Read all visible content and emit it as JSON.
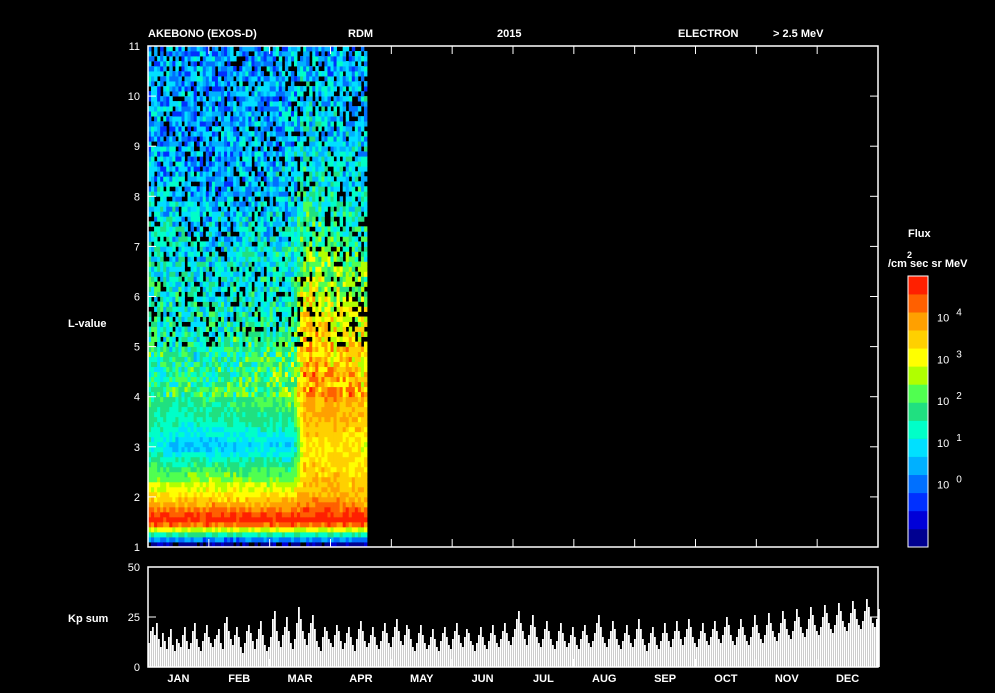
{
  "header": {
    "satellite": "AKEBONO (EXOS-D)",
    "instrument": "RDM",
    "year": "2015",
    "particle": "ELECTRON",
    "energy": "> 2.5 MeV"
  },
  "chart_data": [
    {
      "type": "heatmap",
      "ylabel": "L-value",
      "ylim": [
        1,
        11
      ],
      "y_ticks": [
        "1",
        "2",
        "3",
        "4",
        "5",
        "6",
        "7",
        "8",
        "9",
        "10",
        "11"
      ],
      "x_categories": [
        "JAN",
        "FEB",
        "MAR",
        "APR",
        "MAY",
        "JUN",
        "JUL",
        "AUG",
        "SEP",
        "OCT",
        "NOV",
        "DEC"
      ],
      "data_coverage_months": [
        0.0,
        3.6
      ],
      "colorbar": {
        "title": "Flux",
        "units_main": "/cm sec sr MeV",
        "units_exp": "2",
        "scale": "log",
        "labels": [
          {
            "base": "10",
            "exp": "0",
            "logv": 0
          },
          {
            "base": "10",
            "exp": "1",
            "logv": 1
          },
          {
            "base": "10",
            "exp": "2",
            "logv": 2
          },
          {
            "base": "10",
            "exp": "3",
            "logv": 3
          },
          {
            "base": "10",
            "exp": "4",
            "logv": 4
          }
        ],
        "range_log": [
          -1.5,
          5.0
        ],
        "colors": [
          "#000090",
          "#0000d8",
          "#0030ff",
          "#0070ff",
          "#00b0ff",
          "#00e0ff",
          "#00ffc8",
          "#20e080",
          "#50ff50",
          "#b0ff00",
          "#ffff00",
          "#ffd000",
          "#ffa000",
          "#ff6000",
          "#ff2000"
        ]
      },
      "profiles": [
        {
          "m": 0.0,
          "L": [
            1.0,
            1.5,
            2.0,
            2.5,
            3.0,
            3.5,
            4.0,
            5.0,
            6.0,
            7.0,
            8.5,
            11.0
          ],
          "logf": [
            -2,
            5.0,
            3.4,
            2.1,
            1.2,
            1.7,
            1.8,
            1.6,
            1.4,
            1.2,
            0.6,
            0.3
          ]
        },
        {
          "m": 0.5,
          "L": [
            1.0,
            1.5,
            2.0,
            2.5,
            3.0,
            3.5,
            4.0,
            5.0,
            6.0,
            7.0,
            8.5,
            11.0
          ],
          "logf": [
            -2,
            5.0,
            3.3,
            2.0,
            0.6,
            1.4,
            1.6,
            1.4,
            1.2,
            1.0,
            0.5,
            0.3
          ]
        },
        {
          "m": 1.0,
          "L": [
            1.0,
            1.5,
            2.0,
            2.5,
            3.0,
            3.5,
            4.0,
            5.0,
            6.0,
            7.0,
            8.5,
            11.0
          ],
          "logf": [
            -2,
            5.0,
            3.4,
            2.2,
            0.6,
            1.5,
            1.8,
            1.5,
            1.1,
            0.8,
            0.4,
            0.3
          ]
        },
        {
          "m": 1.5,
          "L": [
            1.0,
            1.5,
            2.0,
            2.5,
            3.0,
            3.5,
            4.0,
            5.0,
            6.0,
            7.0,
            8.5,
            11.0
          ],
          "logf": [
            -2,
            5.0,
            3.3,
            2.0,
            0.8,
            1.6,
            1.9,
            1.6,
            1.3,
            0.9,
            0.5,
            0.3
          ]
        },
        {
          "m": 2.4,
          "L": [
            1.0,
            1.5,
            2.0,
            2.5,
            3.0,
            3.5,
            4.0,
            5.0,
            6.0,
            7.0,
            8.5,
            11.0
          ],
          "logf": [
            -2,
            5.0,
            3.3,
            2.0,
            0.8,
            1.6,
            2.4,
            1.8,
            1.4,
            1.1,
            0.7,
            0.4
          ]
        },
        {
          "m": 2.55,
          "L": [
            1.0,
            1.5,
            2.0,
            2.5,
            3.0,
            3.5,
            4.0,
            5.0,
            6.0,
            7.0,
            8.5,
            11.0
          ],
          "logf": [
            -2,
            5.0,
            3.8,
            3.5,
            3.3,
            3.6,
            3.8,
            3.6,
            3.1,
            2.1,
            1.2,
            0.6
          ]
        },
        {
          "m": 3.0,
          "L": [
            1.0,
            1.5,
            2.0,
            2.5,
            3.0,
            3.5,
            4.0,
            5.0,
            6.0,
            7.0,
            8.5,
            11.0
          ],
          "logf": [
            -2,
            5.0,
            3.9,
            3.4,
            3.3,
            3.7,
            3.9,
            3.5,
            2.7,
            1.8,
            1.0,
            0.5
          ]
        },
        {
          "m": 3.6,
          "L": [
            1.0,
            1.5,
            2.0,
            2.5,
            3.0,
            3.5,
            4.0,
            5.0,
            6.0,
            7.0,
            8.5,
            11.0
          ],
          "logf": [
            -2,
            5.0,
            3.6,
            3.3,
            3.1,
            3.5,
            3.6,
            3.2,
            2.4,
            1.6,
            0.9,
            0.5
          ]
        }
      ]
    },
    {
      "type": "bar",
      "ylabel": "Kp sum",
      "ylim": [
        0,
        50
      ],
      "y_ticks": [
        "0",
        "25",
        "50"
      ],
      "x_categories": [
        "JAN",
        "FEB",
        "MAR",
        "APR",
        "MAY",
        "JUN",
        "JUL",
        "AUG",
        "SEP",
        "OCT",
        "NOV",
        "DEC"
      ],
      "days_per_month": [
        31,
        28,
        31,
        30,
        31,
        30,
        31,
        31,
        30,
        31,
        30,
        31
      ],
      "values": [
        12,
        18,
        20,
        16,
        22,
        14,
        10,
        17,
        13,
        9,
        15,
        19,
        11,
        8,
        14,
        12,
        10,
        16,
        20,
        13,
        9,
        12,
        18,
        22,
        14,
        10,
        8,
        13,
        17,
        21,
        15,
        12,
        10,
        14,
        16,
        19,
        12,
        9,
        22,
        25,
        18,
        14,
        11,
        16,
        20,
        15,
        10,
        7,
        12,
        18,
        21,
        17,
        13,
        9,
        14,
        19,
        23,
        16,
        11,
        8,
        10,
        15,
        24,
        28,
        18,
        13,
        10,
        16,
        20,
        25,
        18,
        12,
        9,
        14,
        22,
        30,
        24,
        18,
        14,
        11,
        17,
        22,
        26,
        19,
        13,
        10,
        8,
        15,
        20,
        18,
        14,
        12,
        10,
        16,
        21,
        18,
        13,
        9,
        12,
        17,
        20,
        15,
        11,
        8,
        14,
        19,
        23,
        18,
        13,
        10,
        12,
        16,
        20,
        15,
        11,
        9,
        13,
        18,
        22,
        17,
        12,
        10,
        15,
        20,
        24,
        18,
        13,
        11,
        16,
        21,
        19,
        14,
        10,
        8,
        12,
        17,
        21,
        16,
        12,
        9,
        11,
        15,
        19,
        14,
        10,
        8,
        13,
        17,
        20,
        15,
        11,
        9,
        14,
        18,
        22,
        16,
        12,
        10,
        15,
        19,
        17,
        13,
        11,
        8,
        12,
        16,
        20,
        15,
        11,
        9,
        13,
        17,
        21,
        16,
        12,
        10,
        14,
        18,
        22,
        17,
        13,
        11,
        15,
        19,
        24,
        28,
        22,
        18,
        14,
        11,
        16,
        21,
        26,
        20,
        15,
        12,
        10,
        14,
        19,
        23,
        18,
        14,
        11,
        9,
        13,
        18,
        22,
        17,
        13,
        10,
        12,
        16,
        20,
        15,
        11,
        9,
        14,
        18,
        21,
        16,
        12,
        10,
        13,
        17,
        22,
        26,
        20,
        15,
        12,
        10,
        14,
        18,
        23,
        19,
        14,
        11,
        9,
        13,
        17,
        21,
        16,
        12,
        10,
        14,
        19,
        24,
        19,
        14,
        11,
        8,
        12,
        17,
        20,
        15,
        11,
        9,
        13,
        17,
        22,
        17,
        13,
        10,
        14,
        18,
        23,
        18,
        14,
        11,
        15,
        19,
        24,
        20,
        15,
        12,
        10,
        14,
        18,
        22,
        17,
        13,
        11,
        15,
        19,
        23,
        18,
        14,
        12,
        16,
        20,
        25,
        21,
        16,
        13,
        11,
        15,
        19,
        24,
        20,
        16,
        13,
        11,
        15,
        20,
        26,
        21,
        17,
        14,
        12,
        16,
        21,
        27,
        22,
        18,
        15,
        13,
        17,
        22,
        28,
        24,
        19,
        16,
        14,
        18,
        23,
        29,
        25,
        20,
        17,
        15,
        19,
        24,
        30,
        26,
        21,
        18,
        16,
        20,
        25,
        31,
        27,
        22,
        19,
        17,
        21,
        26,
        32,
        28,
        23,
        20,
        18,
        22,
        27,
        33,
        29,
        24,
        21,
        19,
        23,
        28,
        34,
        30,
        25,
        22,
        20,
        24,
        29
      ]
    }
  ]
}
